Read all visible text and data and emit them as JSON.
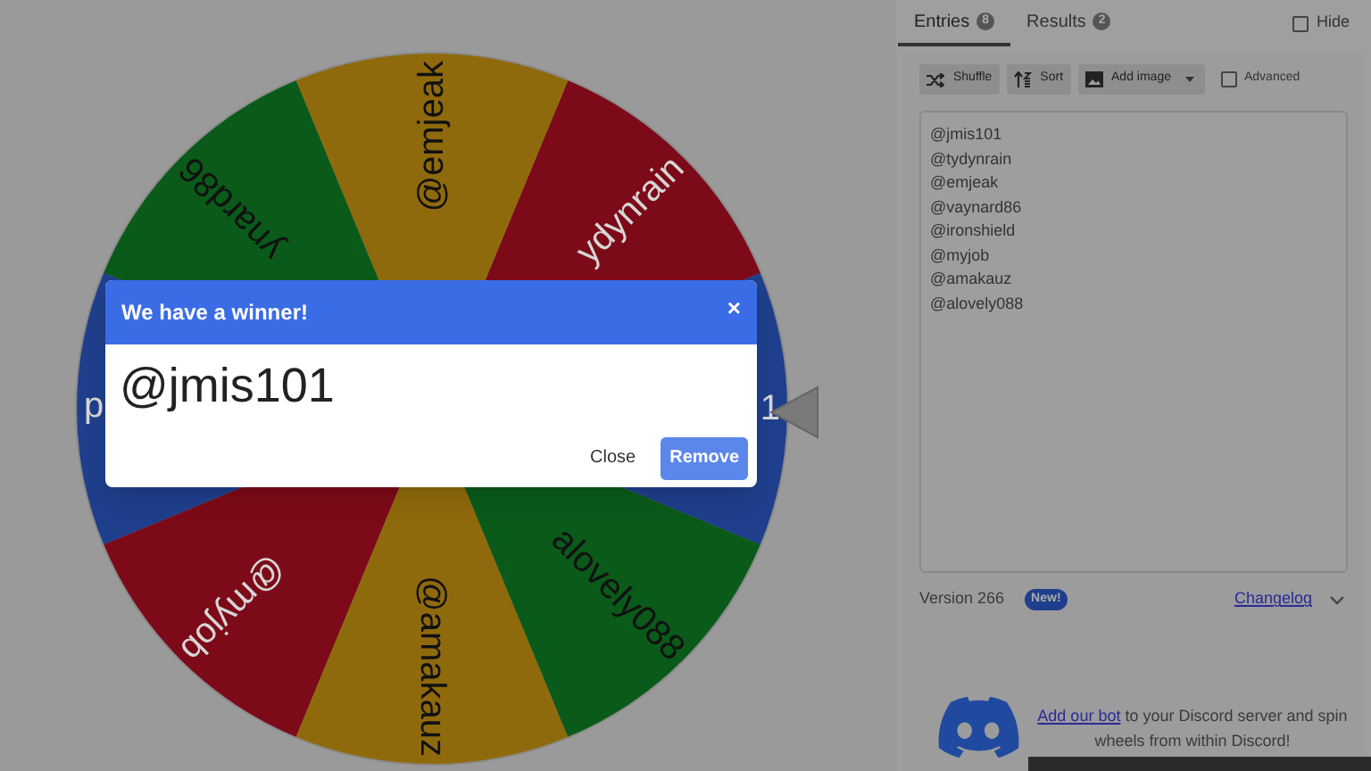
{
  "wheel": {
    "slices": [
      {
        "label": "1",
        "color": "#1f3f8c"
      },
      {
        "label": "ydynrain",
        "color": "#7d0a18"
      },
      {
        "label": "@emjeak",
        "color": "#8f6a0c"
      },
      {
        "label": "ynard86",
        "color": "#0a5a1a"
      },
      {
        "label": "d",
        "color": "#1f3f8c"
      },
      {
        "label": "@myjob",
        "color": "#7d0a18"
      },
      {
        "label": "@amakauz",
        "color": "#8f6a0c"
      },
      {
        "label": "alovely088",
        "color": "#0a5a1a"
      }
    ]
  },
  "dialog": {
    "title": "We have a winner!",
    "close": "×",
    "winner": "@jmis101",
    "buttons": [
      "Close",
      "Remove"
    ]
  },
  "tabs": [
    {
      "label": "Entries",
      "count": "8",
      "selected": true
    },
    {
      "label": "Results",
      "count": "2",
      "selected": false
    }
  ],
  "hide": {
    "label": "Hide",
    "checked": false
  },
  "toolbar": [
    {
      "kind": "shuffle",
      "label": "Shuffle"
    },
    {
      "kind": "sort",
      "label": "Sort"
    },
    {
      "kind": "image",
      "label": "Add image"
    }
  ],
  "advanced": {
    "label": "Advanced",
    "checked": false
  },
  "entries": [
    "@jmis101",
    "@tydynrain",
    "@emjeak",
    "@vaynard86",
    "@ironshield",
    "@myjob",
    "@amakauz",
    "@alovely088"
  ],
  "version": {
    "text": "Version 266",
    "badge": "New!",
    "link": "Changelog"
  },
  "discord": {
    "link": "Add our bot",
    "text": " to your Discord server and spin wheels from within Discord!"
  }
}
